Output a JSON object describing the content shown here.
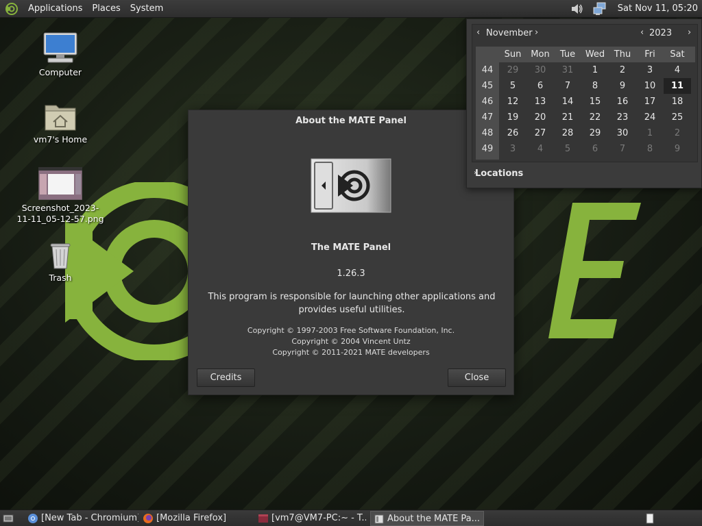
{
  "top_panel": {
    "menus": [
      "Applications",
      "Places",
      "System"
    ],
    "clock": "Sat Nov 11, 05:20",
    "tray_icons": [
      "volume-icon",
      "network-icon"
    ]
  },
  "desktop_icons": [
    {
      "name": "computer",
      "label": "Computer",
      "icon": "computer-icon"
    },
    {
      "name": "home",
      "label": "vm7's Home",
      "icon": "home-folder-icon"
    },
    {
      "name": "screenshot",
      "label": "Screenshot_2023-11-11_05-12-57.png",
      "icon": "image-thumbnail-icon"
    },
    {
      "name": "trash",
      "label": "Trash",
      "icon": "trash-icon"
    }
  ],
  "dialog": {
    "title": "About the MATE Panel",
    "program_name": "The MATE Panel",
    "version": "1.26.3",
    "comment": "This program is responsible for launching other applications and provides useful utilities.",
    "copyright": [
      "Copyright © 1997-2003 Free Software Foundation, Inc.",
      "Copyright © 2004 Vincent Untz",
      "Copyright © 2011-2021 MATE developers"
    ],
    "credits_label": "Credits",
    "close_label": "Close"
  },
  "calendar": {
    "month": "November",
    "year": "2023",
    "weekdays": [
      "Sun",
      "Mon",
      "Tue",
      "Wed",
      "Thu",
      "Fri",
      "Sat"
    ],
    "weeks": [
      {
        "num": "44",
        "days": [
          "29",
          "30",
          "31",
          "1",
          "2",
          "3",
          "4"
        ],
        "dim": [
          true,
          true,
          true,
          false,
          false,
          false,
          false
        ]
      },
      {
        "num": "45",
        "days": [
          "5",
          "6",
          "7",
          "8",
          "9",
          "10",
          "11"
        ],
        "dim": [
          false,
          false,
          false,
          false,
          false,
          false,
          false
        ]
      },
      {
        "num": "46",
        "days": [
          "12",
          "13",
          "14",
          "15",
          "16",
          "17",
          "18"
        ],
        "dim": [
          false,
          false,
          false,
          false,
          false,
          false,
          false
        ]
      },
      {
        "num": "47",
        "days": [
          "19",
          "20",
          "21",
          "22",
          "23",
          "24",
          "25"
        ],
        "dim": [
          false,
          false,
          false,
          false,
          false,
          false,
          false
        ]
      },
      {
        "num": "48",
        "days": [
          "26",
          "27",
          "28",
          "29",
          "30",
          "1",
          "2"
        ],
        "dim": [
          false,
          false,
          false,
          false,
          false,
          true,
          true
        ]
      },
      {
        "num": "49",
        "days": [
          "3",
          "4",
          "5",
          "6",
          "7",
          "8",
          "9"
        ],
        "dim": [
          true,
          true,
          true,
          true,
          true,
          true,
          true
        ]
      }
    ],
    "today": "11",
    "locations_label": "Locations"
  },
  "taskbar": {
    "items": [
      {
        "label": "[New Tab - Chromium]",
        "icon": "chromium-icon",
        "active": false
      },
      {
        "label": "[Mozilla Firefox]",
        "icon": "firefox-icon",
        "active": false
      },
      {
        "label": "[vm7@VM7-PC:~ - T...",
        "icon": "terminal-icon",
        "active": false
      },
      {
        "label": "About the MATE Pa...",
        "icon": "about-window-icon",
        "active": true
      }
    ]
  },
  "colors": {
    "accent_green": "#87b33d",
    "panel_bg": "#333333",
    "dialog_bg": "#3a3a3a"
  }
}
